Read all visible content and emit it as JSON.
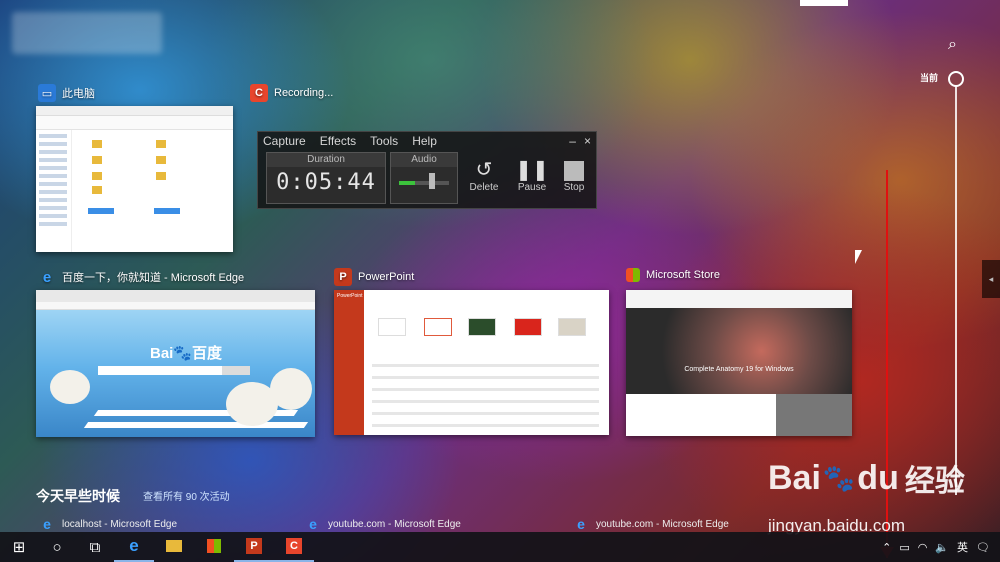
{
  "windows": {
    "explorer": {
      "title": "此电脑"
    },
    "recording": {
      "title": "Recording..."
    },
    "edge": {
      "title": "百度一下，你就知道 - Microsoft Edge",
      "logo": "Bai",
      "logo_cn": "百度"
    },
    "powerpoint": {
      "title": "PowerPoint",
      "side_label": "PowerPoint"
    },
    "store": {
      "title": "Microsoft Store",
      "hero_text": "Complete Anatomy 19 for Windows"
    }
  },
  "recorder": {
    "menu": [
      "Capture",
      "Effects",
      "Tools",
      "Help"
    ],
    "duration_label": "Duration",
    "duration_value": "0:05:44",
    "audio_label": "Audio",
    "buttons": [
      {
        "label": "Delete",
        "icon": "undo-icon"
      },
      {
        "label": "Pause",
        "icon": "pause-icon"
      },
      {
        "label": "Stop",
        "icon": "stop-icon"
      }
    ]
  },
  "timeline": {
    "header": "今天早些时候",
    "see_all": "查看所有 90 次活动",
    "current_label": "当前",
    "history": [
      {
        "label": "localhost - Microsoft Edge",
        "icon": "edge-icon"
      },
      {
        "label": "youtube.com - Microsoft Edge",
        "icon": "edge-icon"
      },
      {
        "label": "youtube.com - Microsoft Edge",
        "icon": "edge-icon"
      }
    ]
  },
  "tray": {
    "ime": "英"
  },
  "watermark": {
    "brand": "Bai",
    "brand2": "du",
    "cn": "经验",
    "url": "jingyan.baidu.com"
  },
  "colors": {
    "accent": "#e01010",
    "ppt": "#c4391c",
    "edge": "#1f7fd6",
    "taskbar": "#12121a"
  }
}
